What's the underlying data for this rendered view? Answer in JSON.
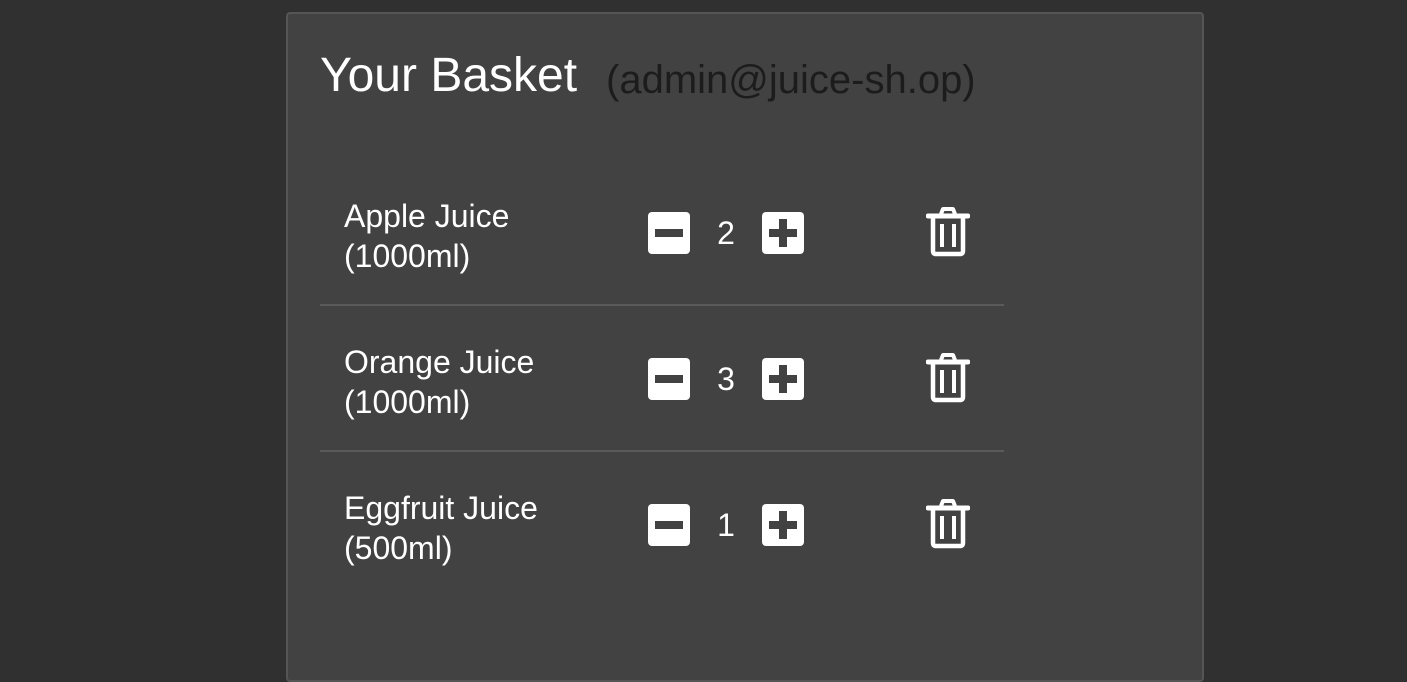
{
  "basket": {
    "title": "Your Basket",
    "user": "(admin@juice-sh.op)",
    "items": [
      {
        "name": "Apple Juice (1000ml)",
        "quantity": "2"
      },
      {
        "name": "Orange Juice (1000ml)",
        "quantity": "3"
      },
      {
        "name": "Eggfruit Juice (500ml)",
        "quantity": "1"
      }
    ]
  },
  "icons": {
    "decrease": "minus-square-icon",
    "increase": "plus-square-icon",
    "remove": "trash-icon"
  },
  "colors": {
    "page_background": "#303030",
    "card_background": "#424242",
    "text": "#ffffff",
    "user_text": "#1c1c1c"
  }
}
